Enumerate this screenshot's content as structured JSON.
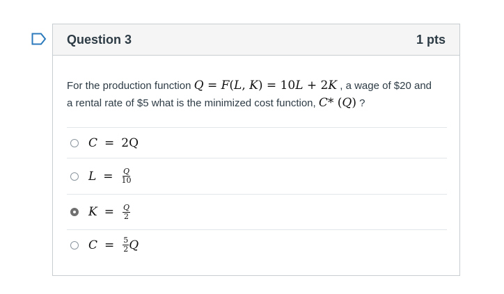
{
  "question": {
    "title": "Question 3",
    "points": "1 pts",
    "text_before": "For the production function ",
    "math_function": "Q = F(L, K) = 10L + 2K",
    "text_middle": " , a wage of $20 and a rental rate of $5 what is the minimized cost function, ",
    "math_cost": "C* (Q)",
    "text_after": " ?"
  },
  "answers": [
    {
      "lhs": "C",
      "eq": "=",
      "rhs": "2Q",
      "selected": false
    },
    {
      "lhs": "L",
      "eq": "=",
      "frac_num": "Q",
      "frac_den": "10",
      "selected": false
    },
    {
      "lhs": "K",
      "eq": "=",
      "frac_num": "Q",
      "frac_den": "2",
      "selected": true
    },
    {
      "lhs": "C",
      "eq": "=",
      "frac_num": "5",
      "frac_den": "2",
      "rhs_suffix": "Q",
      "selected": false
    }
  ],
  "colors": {
    "flag": "#2b7abc",
    "border": "#c7cdd1",
    "header_bg": "#f5f5f5",
    "text": "#2d3b45"
  },
  "icons": {
    "flag": "bookmark-flag-icon"
  }
}
